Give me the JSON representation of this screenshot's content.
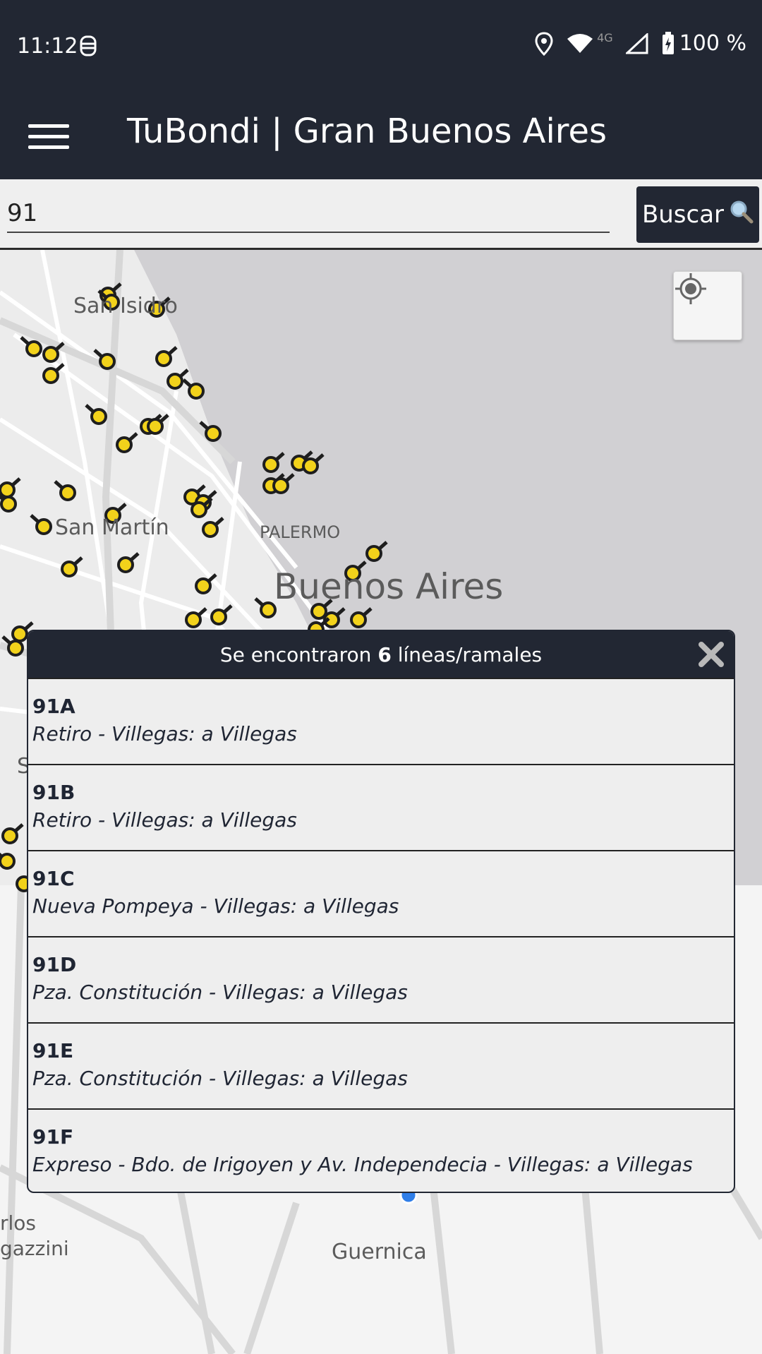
{
  "status_bar": {
    "time": "11:12",
    "battery": "100 %",
    "network": "4G"
  },
  "app_bar": {
    "title": "TuBondi | Gran Buenos Aires",
    "menu_icon": "hamburger-menu-icon"
  },
  "search": {
    "value": "91",
    "button_label": "Buscar",
    "button_icon": "magnifier-icon"
  },
  "map": {
    "labels": {
      "san_isidro": "San Isidro",
      "san_martin": "San Martín",
      "palermo": "PALERMO",
      "buenos_aires": "Buenos Aires",
      "carlos": "rlos",
      "gazzini": "gazzini",
      "guernica": "Guernica",
      "s": "S"
    },
    "marker_color": "#f2d21b",
    "water_color": "#d1d0d3"
  },
  "results": {
    "prefix": "Se encontraron",
    "count": "6",
    "suffix": "líneas/ramales",
    "items": [
      {
        "code": "91A",
        "desc": "Retiro - Villegas: a Villegas"
      },
      {
        "code": "91B",
        "desc": "Retiro - Villegas: a Villegas"
      },
      {
        "code": "91C",
        "desc": "Nueva Pompeya - Villegas: a Villegas"
      },
      {
        "code": "91D",
        "desc": "Pza. Constitución - Villegas: a Villegas"
      },
      {
        "code": "91E",
        "desc": "Pza. Constitución - Villegas: a Villegas"
      },
      {
        "code": "91F",
        "desc": "Expreso - Bdo. de Irigoyen y Av. Independecia - Villegas: a Villegas"
      }
    ]
  },
  "colors": {
    "header_bg": "#222733",
    "panel_bg": "#eeeeee"
  }
}
